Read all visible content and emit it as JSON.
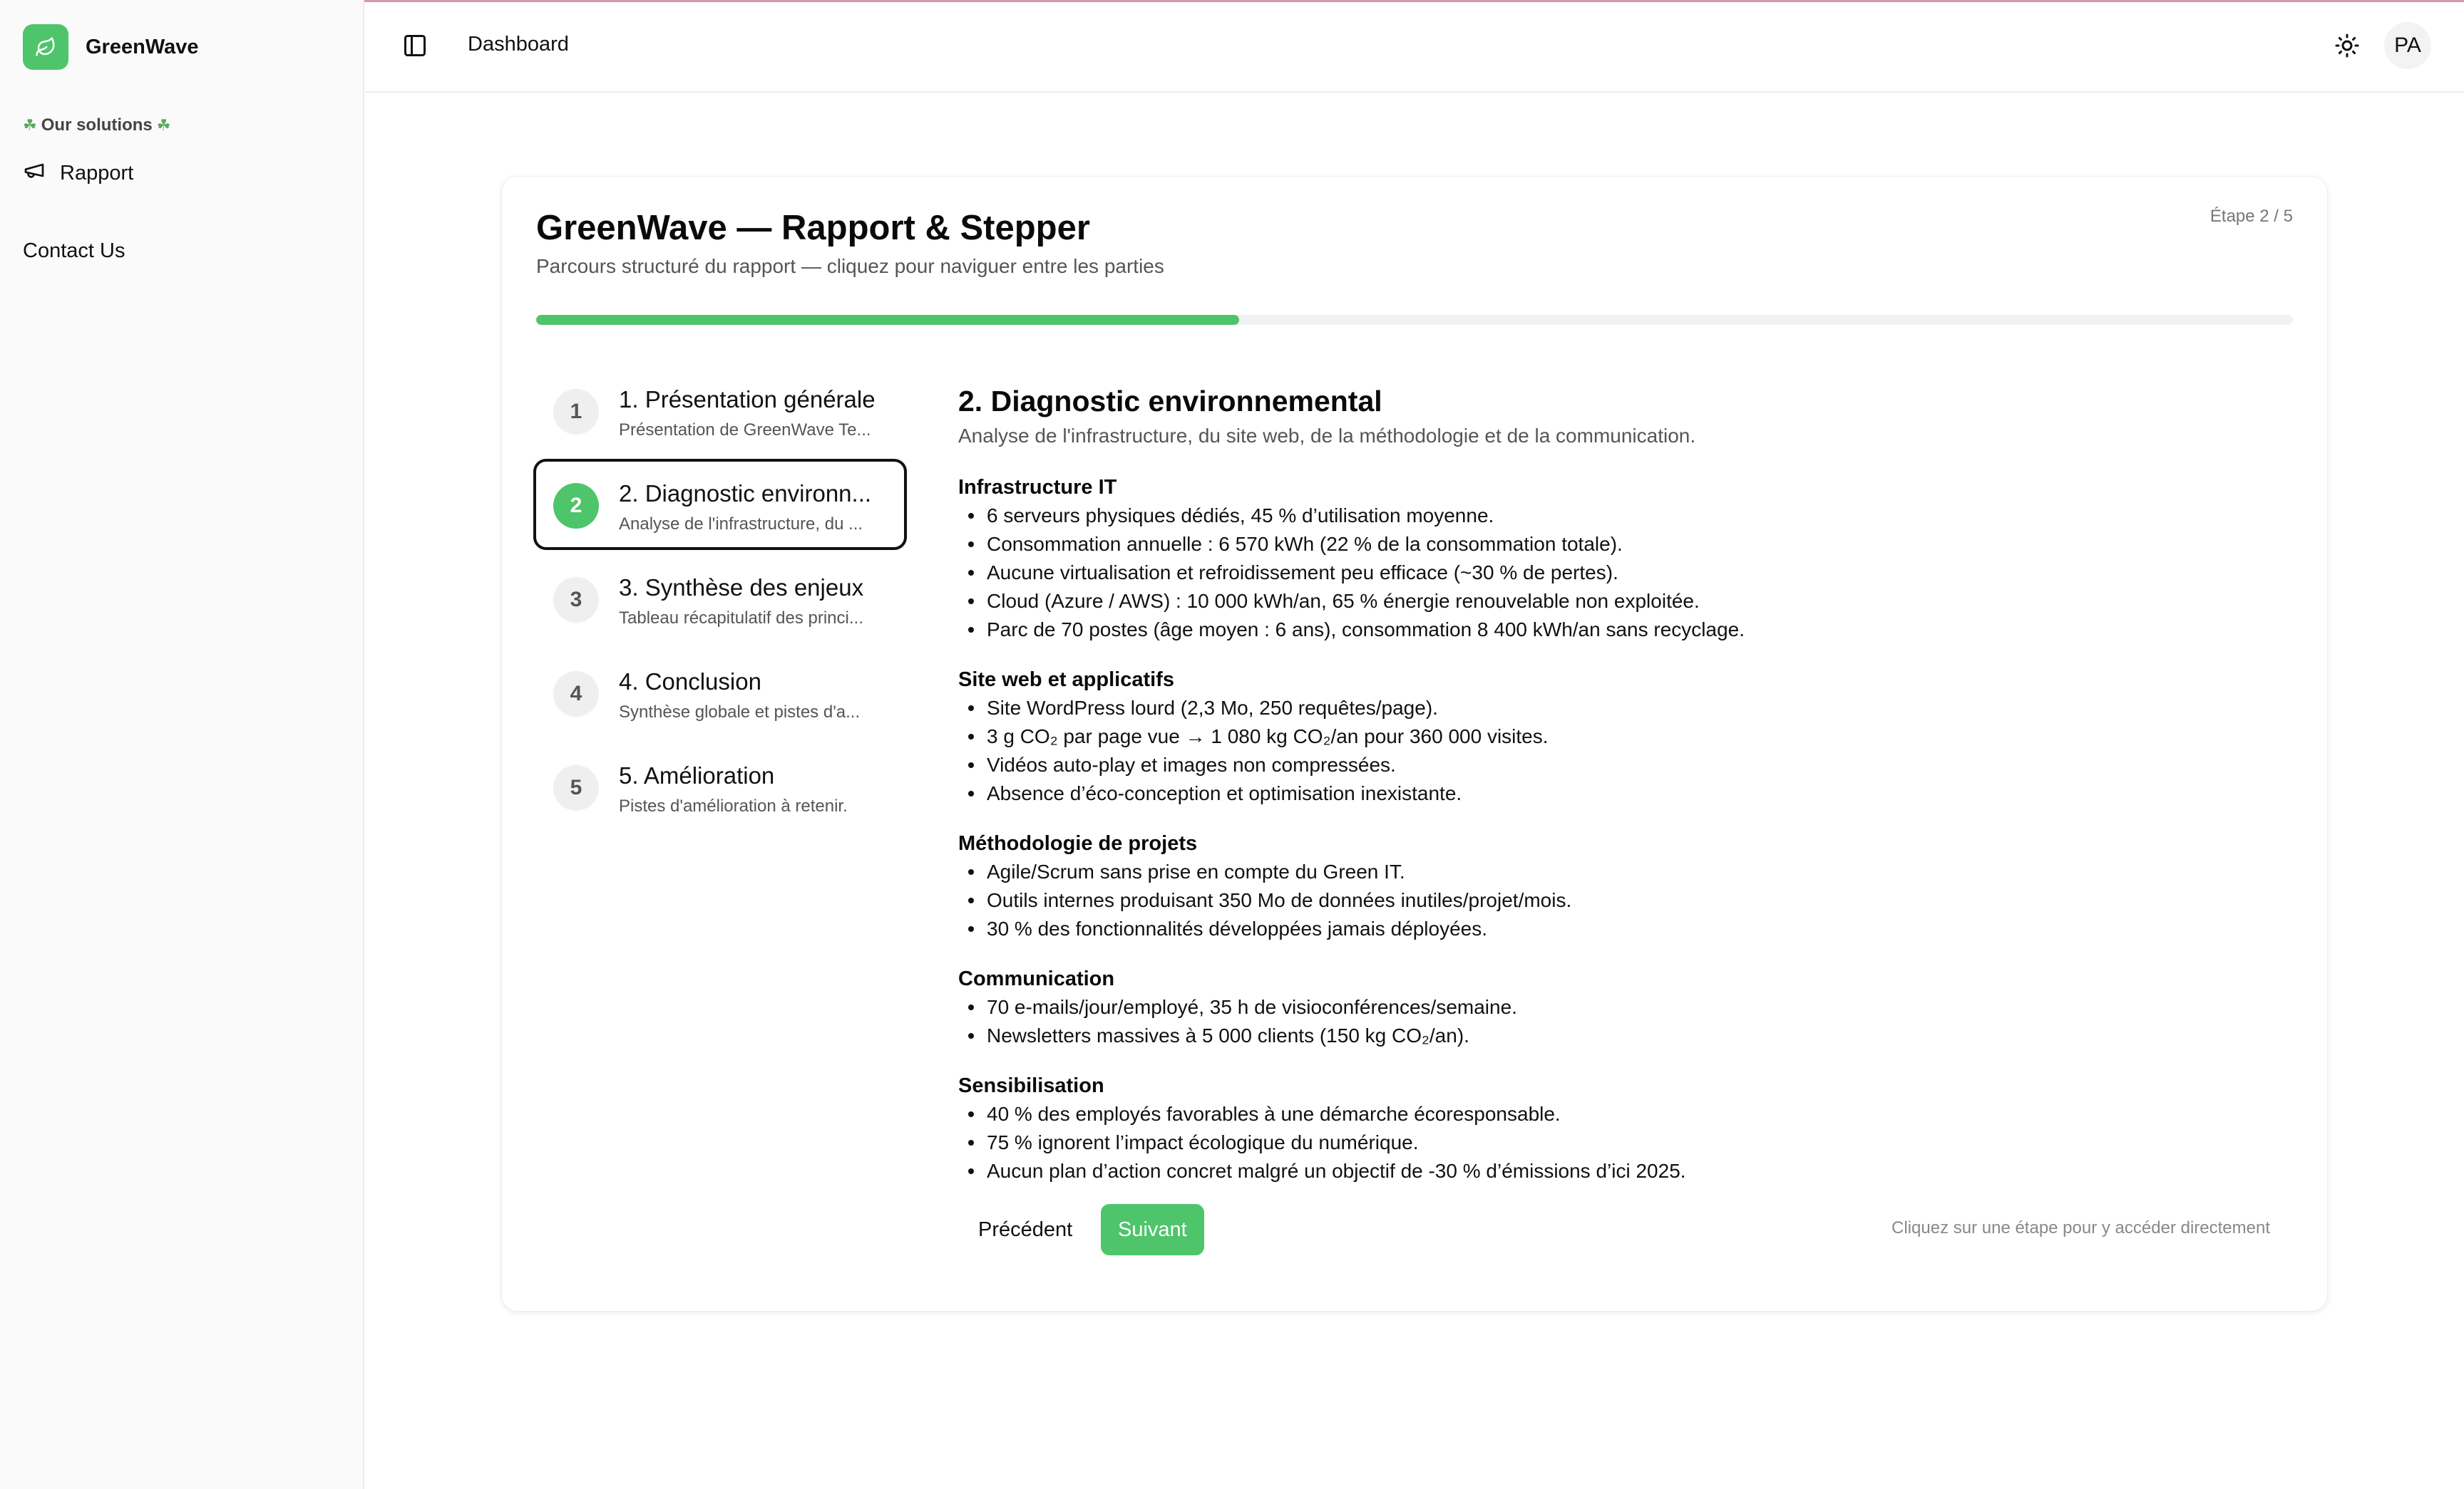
{
  "app": {
    "brand_name": "GreenWave",
    "accent_color": "#4ec56a"
  },
  "sidebar": {
    "group_label": "Our solutions",
    "items": [
      {
        "label": "Rapport",
        "icon": "megaphone-icon"
      }
    ],
    "contact_label": "Contact Us"
  },
  "header": {
    "title": "Dashboard",
    "avatar_initials": "PA"
  },
  "card": {
    "title": "GreenWave — Rapport & Stepper",
    "subtitle": "Parcours structuré du rapport — cliquez pour naviguer entre les parties",
    "step_counter": "Étape 2 / 5",
    "progress_fraction": 0.4
  },
  "steps": [
    {
      "number": "1",
      "title": "1. Présentation générale",
      "description": "Présentation de GreenWave Te...",
      "active": false
    },
    {
      "number": "2",
      "title": "2. Diagnostic environn...",
      "description": "Analyse de l'infrastructure, du ...",
      "active": true
    },
    {
      "number": "3",
      "title": "3. Synthèse des enjeux",
      "description": "Tableau récapitulatif des princi...",
      "active": false
    },
    {
      "number": "4",
      "title": "4. Conclusion",
      "description": "Synthèse globale et pistes d'a...",
      "active": false
    },
    {
      "number": "5",
      "title": "5. Amélioration",
      "description": "Pistes d'amélioration à retenir.",
      "active": false
    }
  ],
  "content": {
    "title": "2. Diagnostic environnemental",
    "subtitle": "Analyse de l'infrastructure, du site web, de la méthodologie et de la communication.",
    "sections": [
      {
        "title": "Infrastructure IT",
        "items": [
          "6 serveurs physiques dédiés, 45 % d’utilisation moyenne.",
          "Consommation annuelle : 6 570 kWh (22 % de la consommation totale).",
          "Aucune virtualisation et refroidissement peu efficace (~30 % de pertes).",
          "Cloud (Azure / AWS) : 10 000 kWh/an, 65 % énergie renouvelable non exploitée.",
          "Parc de 70 postes (âge moyen : 6 ans), consommation 8 400 kWh/an sans recyclage."
        ]
      },
      {
        "title": "Site web et applicatifs",
        "items": [
          "Site WordPress lourd (2,3 Mo, 250 requêtes/page).",
          "3 g CO₂ par page vue → 1 080 kg CO₂/an pour 360 000 visites.",
          "Vidéos auto-play et images non compressées.",
          "Absence d’éco-conception et optimisation inexistante."
        ]
      },
      {
        "title": "Méthodologie de projets",
        "items": [
          "Agile/Scrum sans prise en compte du Green IT.",
          "Outils internes produisant 350 Mo de données inutiles/projet/mois.",
          "30 % des fonctionnalités développées jamais déployées."
        ]
      },
      {
        "title": "Communication",
        "items": [
          "70 e-mails/jour/employé, 35 h de visioconférences/semaine.",
          "Newsletters massives à 5 000 clients (150 kg CO₂/an)."
        ]
      },
      {
        "title": "Sensibilisation",
        "items": [
          "40 % des employés favorables à une démarche écoresponsable.",
          "75 % ignorent l’impact écologique du numérique.",
          "Aucun plan d’action concret malgré un objectif de -30 % d’émissions d’ici 2025."
        ]
      }
    ]
  },
  "footer": {
    "prev_label": "Précédent",
    "next_label": "Suivant",
    "hint": "Cliquez sur une étape pour y accéder directement"
  }
}
